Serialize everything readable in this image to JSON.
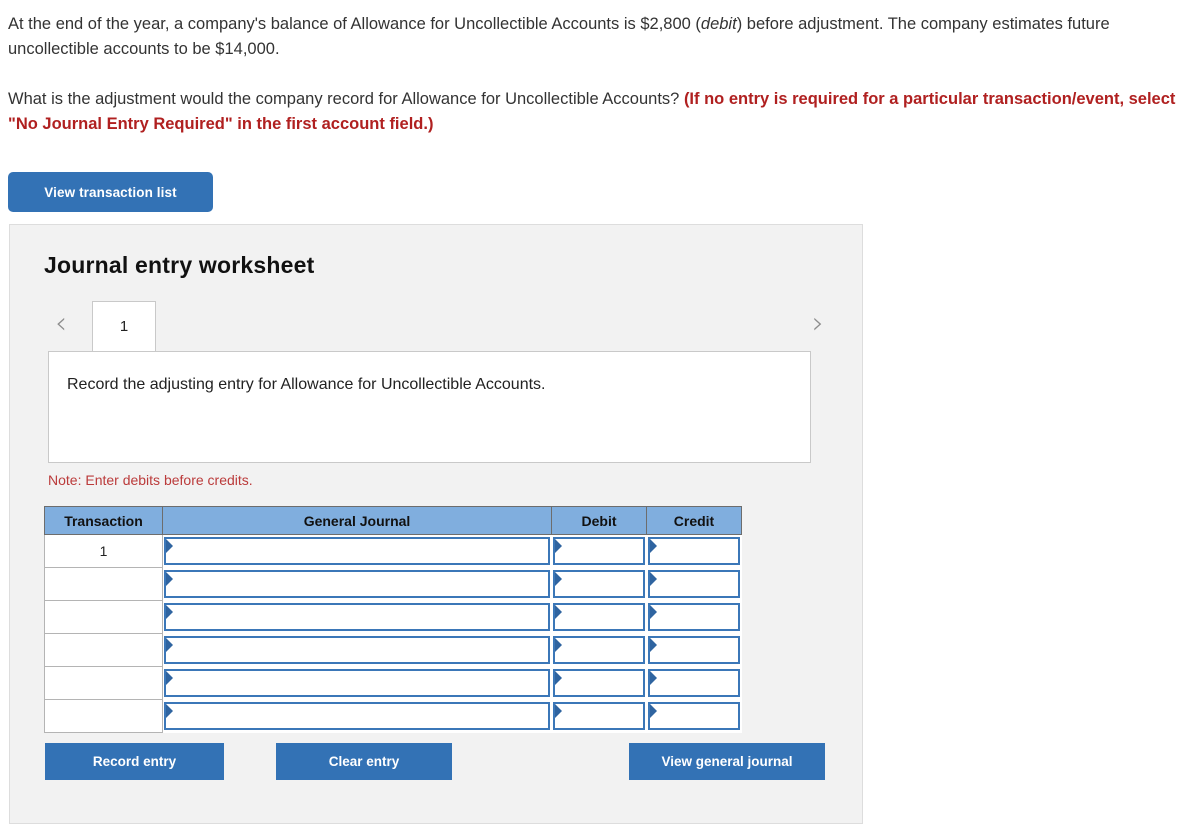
{
  "question": {
    "line1_part1": "At the end of the year, a company's balance of Allowance for Uncollectible Accounts is $2,800 (",
    "line1_italic": "debit",
    "line1_part2": ") before adjustment. The company estimates future uncollectible accounts to be $14,000.",
    "line2_part1": "What is the adjustment would the company record for Allowance for Uncollectible Accounts? ",
    "line2_red": "(If no entry is required for a particular transaction/event, select \"No Journal Entry Required\" in the first account field.)"
  },
  "toolbar": {
    "view_transaction_list_label": "View transaction list"
  },
  "worksheet": {
    "title": "Journal entry worksheet",
    "prev_icon": "chevron-left-icon",
    "next_icon": "chevron-right-icon",
    "tabs": [
      {
        "label": "1",
        "selected": true
      }
    ],
    "description": "Record the adjusting entry for Allowance for Uncollectible Accounts.",
    "note": "Note: Enter debits before credits.",
    "table": {
      "columns": [
        "Transaction",
        "General Journal",
        "Debit",
        "Credit"
      ],
      "rows": [
        {
          "transaction": "1",
          "general_journal": "",
          "debit": "",
          "credit": ""
        },
        {
          "transaction": "",
          "general_journal": "",
          "debit": "",
          "credit": ""
        },
        {
          "transaction": "",
          "general_journal": "",
          "debit": "",
          "credit": ""
        },
        {
          "transaction": "",
          "general_journal": "",
          "debit": "",
          "credit": ""
        },
        {
          "transaction": "",
          "general_journal": "",
          "debit": "",
          "credit": ""
        },
        {
          "transaction": "",
          "general_journal": "",
          "debit": "",
          "credit": ""
        }
      ]
    },
    "actions": {
      "record_entry_label": "Record entry",
      "clear_entry_label": "Clear entry",
      "view_general_journal_label": "View general journal"
    }
  },
  "colors": {
    "accent_blue": "#3372b5",
    "table_header_blue": "#80aede",
    "field_border_blue": "#3b77b8",
    "note_red": "#bb3b3b",
    "emphasis_red": "#b02020",
    "panel_bg": "#f2f2f2"
  }
}
